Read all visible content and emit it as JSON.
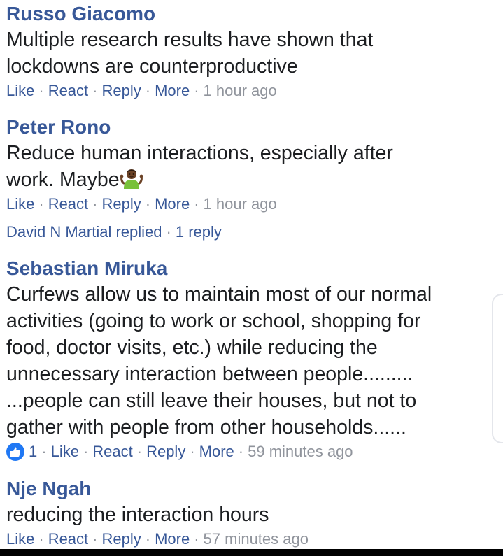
{
  "comments": [
    {
      "author": "Russo Giacomo",
      "lines": [
        "Multiple research results have shown that",
        "lockdowns are counterproductive"
      ],
      "actions": {
        "like": "Like",
        "react": "React",
        "reply": "Reply",
        "more": "More"
      },
      "time": "1 hour ago"
    },
    {
      "author": "Peter Rono",
      "lines": [
        "Reduce human interactions, especially after",
        "work. Maybe"
      ],
      "emoji": "person-shrugging-emoji",
      "actions": {
        "like": "Like",
        "react": "React",
        "reply": "Reply",
        "more": "More"
      },
      "time": "1 hour ago",
      "replies": {
        "name": "David N Martial replied",
        "count": "1 reply"
      }
    },
    {
      "author": "Sebastian Miruka",
      "lines": [
        "Curfews allow us to maintain most of our normal",
        "activities (going to work or school, shopping for",
        "food, doctor visits, etc.) while reducing the",
        "unnecessary interaction between people.........",
        "...people can still leave their houses, but not to",
        "gather with people from other households......"
      ],
      "reactions": {
        "icon": "like-thumb-icon",
        "count": "1"
      },
      "actions": {
        "like": "Like",
        "react": "React",
        "reply": "Reply",
        "more": "More"
      },
      "time": "59 minutes ago"
    },
    {
      "author": "Nje Ngah",
      "lines": [
        "reducing the interaction hours"
      ],
      "actions": {
        "like": "Like",
        "react": "React",
        "reply": "Reply",
        "more": "More"
      },
      "time": "57 minutes ago"
    }
  ],
  "colors": {
    "author": "#385898",
    "text": "#1c1e21",
    "meta": "#90949c",
    "like_badge": "#2078f4"
  }
}
